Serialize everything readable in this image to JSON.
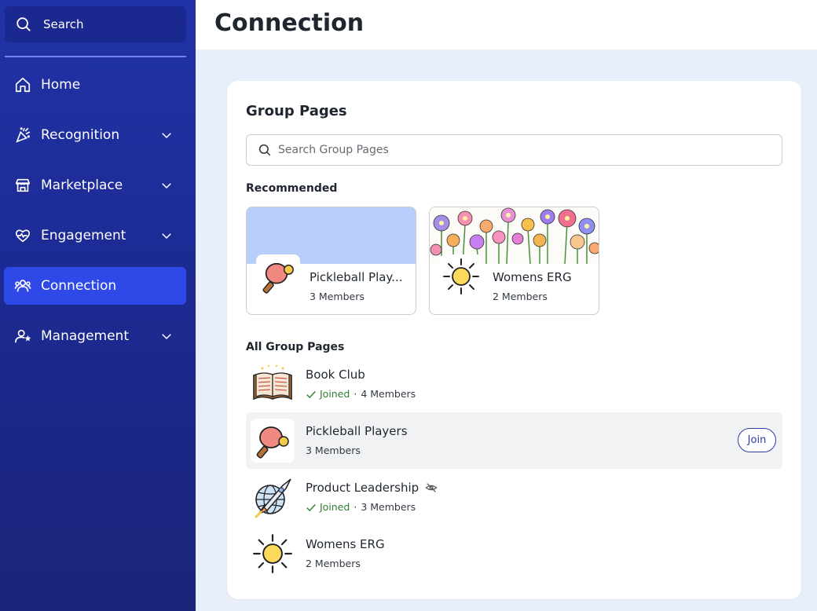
{
  "sidebar": {
    "search_label": "Search",
    "items": [
      {
        "label": "Home",
        "icon": "home-icon",
        "has_chevron": false,
        "active": false
      },
      {
        "label": "Recognition",
        "icon": "party-popper-icon",
        "has_chevron": true,
        "active": false
      },
      {
        "label": "Marketplace",
        "icon": "store-icon",
        "has_chevron": true,
        "active": false
      },
      {
        "label": "Engagement",
        "icon": "heart-pulse-icon",
        "has_chevron": true,
        "active": false
      },
      {
        "label": "Connection",
        "icon": "users-icon",
        "has_chevron": false,
        "active": true
      },
      {
        "label": "Management",
        "icon": "user-star-icon",
        "has_chevron": true,
        "active": false
      }
    ]
  },
  "header": {
    "title": "Connection"
  },
  "main": {
    "card_title": "Group Pages",
    "search_placeholder": "Search Group Pages",
    "recommended_label": "Recommended",
    "recommended": [
      {
        "name": "Pickleball Play...",
        "members": "3 Members",
        "icon": "paddle-icon",
        "banner": "light-blue"
      },
      {
        "name": "Womens ERG",
        "members": "2 Members",
        "icon": "sun-icon",
        "banner": "flowers"
      }
    ],
    "all_label": "All Group Pages",
    "groups": [
      {
        "name": "Book Club",
        "joined_label": "Joined",
        "members": "4 Members",
        "joined": true,
        "icon": "book-icon"
      },
      {
        "name": "Pickleball Players",
        "members": "3 Members",
        "joined": false,
        "join_label": "Join",
        "icon": "paddle-icon"
      },
      {
        "name": "Product Leadership",
        "joined_label": "Joined",
        "members": "3 Members",
        "joined": true,
        "hidden": true,
        "icon": "rocket-globe-icon"
      },
      {
        "name": "Womens ERG",
        "members": "2 Members",
        "joined": false,
        "icon": "sun-icon"
      }
    ],
    "separator": "·"
  },
  "colors": {
    "sidebar": "#1c2a93",
    "active_nav": "#2f49e8",
    "joined_green": "#2e7d32",
    "join_blue": "#2a3aa8"
  }
}
